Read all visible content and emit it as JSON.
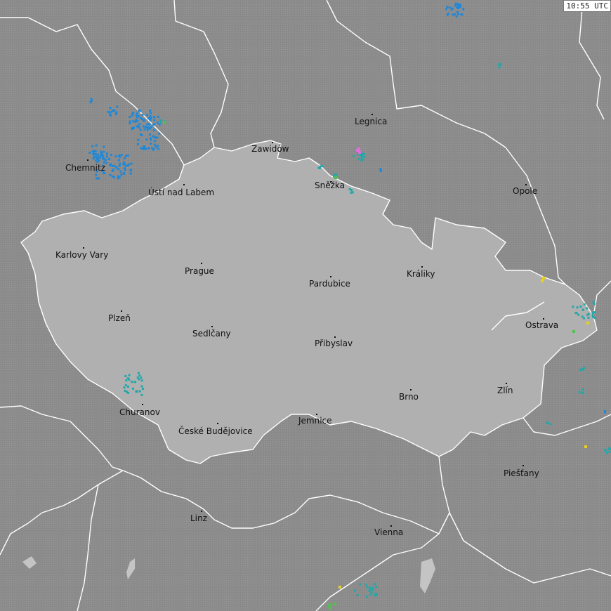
{
  "map": {
    "timestamp": "10:55 UTC",
    "colors": {
      "background": "#8c8c8c",
      "czech_fill": "#b0b0b0",
      "border": "#ffffff",
      "lake": "#c4c4c4",
      "strike_blue": "#1e88d8",
      "strike_teal": "#22a8a8",
      "strike_green": "#50c050",
      "strike_yellow": "#e8d020",
      "strike_magenta": "#e070e0"
    },
    "cities": [
      {
        "name": "Legnica"
      },
      {
        "name": "Zawidów"
      },
      {
        "name": "Chemnitz"
      },
      {
        "name": "Ústí nad Labem"
      },
      {
        "name": "Sněžka"
      },
      {
        "name": "Opole"
      },
      {
        "name": "Karlovy Vary"
      },
      {
        "name": "Prague"
      },
      {
        "name": "Pardubice"
      },
      {
        "name": "Králiky"
      },
      {
        "name": "Plzeň"
      },
      {
        "name": "Sedlčany"
      },
      {
        "name": "Přibyslav"
      },
      {
        "name": "Ostrava"
      },
      {
        "name": "Zlín"
      },
      {
        "name": "Brno"
      },
      {
        "name": "Churanov"
      },
      {
        "name": "České Budějovice"
      },
      {
        "name": "Jemnice"
      },
      {
        "name": "Piešťany"
      },
      {
        "name": "Linz"
      },
      {
        "name": "Vienna"
      }
    ]
  }
}
